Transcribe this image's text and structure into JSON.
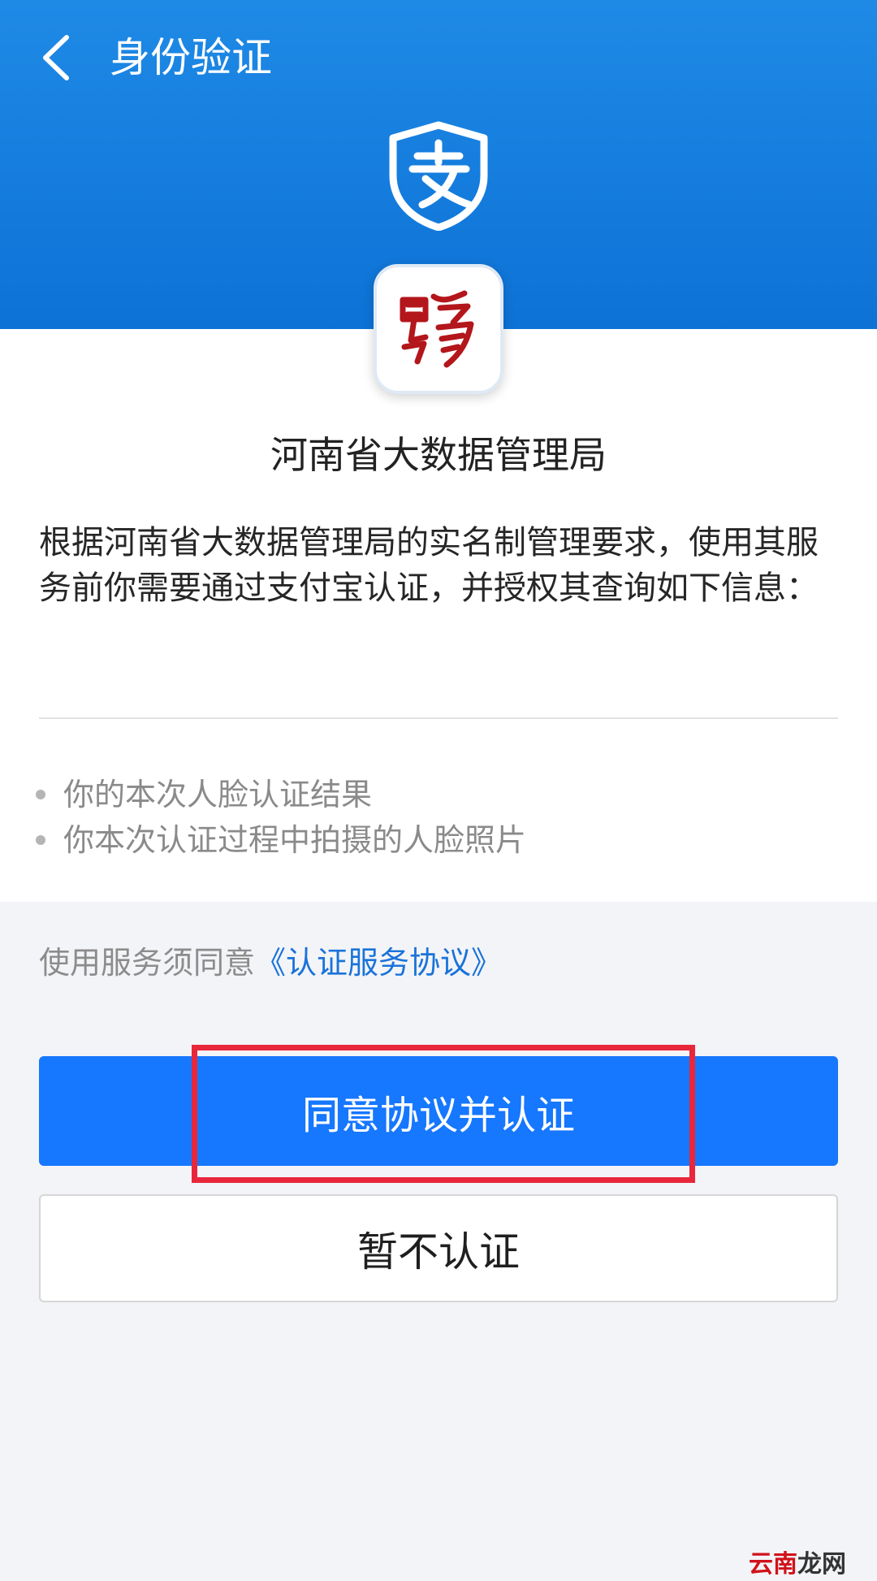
{
  "header": {
    "title": "身份验证",
    "back_icon": "chevron-left-icon",
    "logo_icon": "alipay-shield-icon",
    "gradient_colors": [
      "#1f8ae6",
      "#0d72d6"
    ]
  },
  "app": {
    "icon": "henan-seal-icon",
    "name": "河南省大数据管理局"
  },
  "description": "根据河南省大数据管理局的实名制管理要求，使用其服务前你需要通过支付宝认证，并授权其查询如下信息：",
  "info_items": [
    "你的本次人脸认证结果",
    "你本次认证过程中拍摄的人脸照片"
  ],
  "agreement": {
    "prefix": "使用服务须同意",
    "link": "《认证服务协议》"
  },
  "buttons": {
    "primary": "同意协议并认证",
    "secondary": "暂不认证"
  },
  "watermark": {
    "red": "云南",
    "dark": "龙网"
  },
  "colors": {
    "primary_button": "#1677ff",
    "highlight_box": "#e8273b",
    "link": "#1a73d9"
  }
}
